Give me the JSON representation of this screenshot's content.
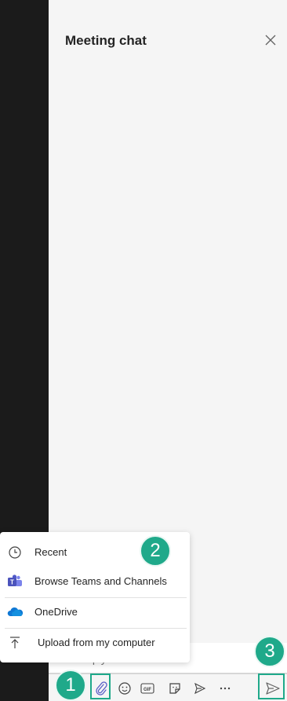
{
  "panel": {
    "title": "Meeting chat"
  },
  "compose": {
    "placeholder": "Reply"
  },
  "attach_menu": {
    "items": [
      {
        "label": "Recent",
        "icon": "clock-icon"
      },
      {
        "label": "Browse Teams and Channels",
        "icon": "teams-icon"
      },
      {
        "label": "OneDrive",
        "icon": "onedrive-icon"
      },
      {
        "label": "Upload from my computer",
        "icon": "upload-icon"
      }
    ]
  },
  "toolbar": {
    "tools": [
      "attach-icon",
      "emoji-icon",
      "gif-icon",
      "sticker-icon",
      "loop-icon",
      "more-icon"
    ],
    "send": "send-icon"
  },
  "callouts": [
    "1",
    "2",
    "3"
  ],
  "colors": {
    "accent": "#1fa98a",
    "brand": "#6264a7",
    "onedrive": "#0f78d4"
  }
}
